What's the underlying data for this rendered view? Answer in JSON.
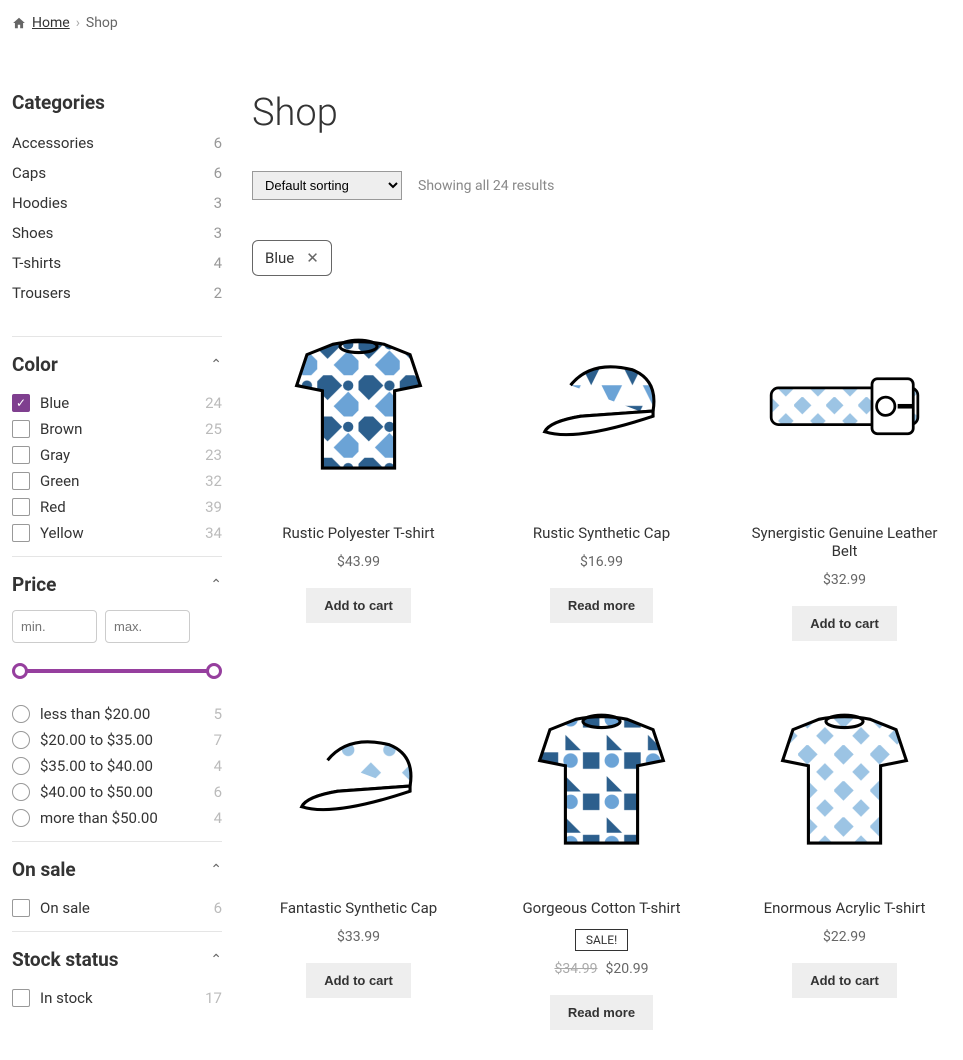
{
  "breadcrumb": {
    "home": "Home",
    "current": "Shop"
  },
  "sidebar": {
    "categories_title": "Categories",
    "categories": [
      {
        "name": "Accessories",
        "count": "6"
      },
      {
        "name": "Caps",
        "count": "6"
      },
      {
        "name": "Hoodies",
        "count": "3"
      },
      {
        "name": "Shoes",
        "count": "3"
      },
      {
        "name": "T-shirts",
        "count": "4"
      },
      {
        "name": "Trousers",
        "count": "2"
      }
    ],
    "color_title": "Color",
    "colors": [
      {
        "name": "Blue",
        "count": "24",
        "checked": true
      },
      {
        "name": "Brown",
        "count": "25",
        "checked": false
      },
      {
        "name": "Gray",
        "count": "23",
        "checked": false
      },
      {
        "name": "Green",
        "count": "32",
        "checked": false
      },
      {
        "name": "Red",
        "count": "39",
        "checked": false
      },
      {
        "name": "Yellow",
        "count": "34",
        "checked": false
      }
    ],
    "price_title": "Price",
    "price_min_placeholder": "min.",
    "price_max_placeholder": "max.",
    "price_ranges": [
      {
        "label": "less than $20.00",
        "count": "5"
      },
      {
        "label": "$20.00 to $35.00",
        "count": "7"
      },
      {
        "label": "$35.00 to $40.00",
        "count": "4"
      },
      {
        "label": "$40.00 to $50.00",
        "count": "6"
      },
      {
        "label": "more than $50.00",
        "count": "4"
      }
    ],
    "onsale_title": "On sale",
    "onsale": {
      "label": "On sale",
      "count": "6"
    },
    "stock_title": "Stock status",
    "stock": {
      "label": "In stock",
      "count": "17"
    }
  },
  "main": {
    "title": "Shop",
    "sort_label": "Default sorting",
    "result_count": "Showing all 24 results",
    "active_filter": "Blue",
    "sale_badge": "SALE!",
    "products": [
      {
        "title": "Rustic Polyester T-shirt",
        "price": "$43.99",
        "btn": "Add to cart",
        "img": "tshirt1"
      },
      {
        "title": "Rustic Synthetic Cap",
        "price": "$16.99",
        "btn": "Read more",
        "img": "cap1"
      },
      {
        "title": "Synergistic Genuine Leather Belt",
        "price": "$32.99",
        "btn": "Add to cart",
        "img": "belt"
      },
      {
        "title": "Fantastic Synthetic Cap",
        "price": "$33.99",
        "btn": "Add to cart",
        "img": "cap2"
      },
      {
        "title": "Gorgeous Cotton T-shirt",
        "old_price": "$34.99",
        "price": "$20.99",
        "btn": "Read more",
        "sale": true,
        "img": "tshirt2"
      },
      {
        "title": "Enormous Acrylic T-shirt",
        "price": "$22.99",
        "btn": "Add to cart",
        "img": "tshirt3"
      }
    ]
  }
}
